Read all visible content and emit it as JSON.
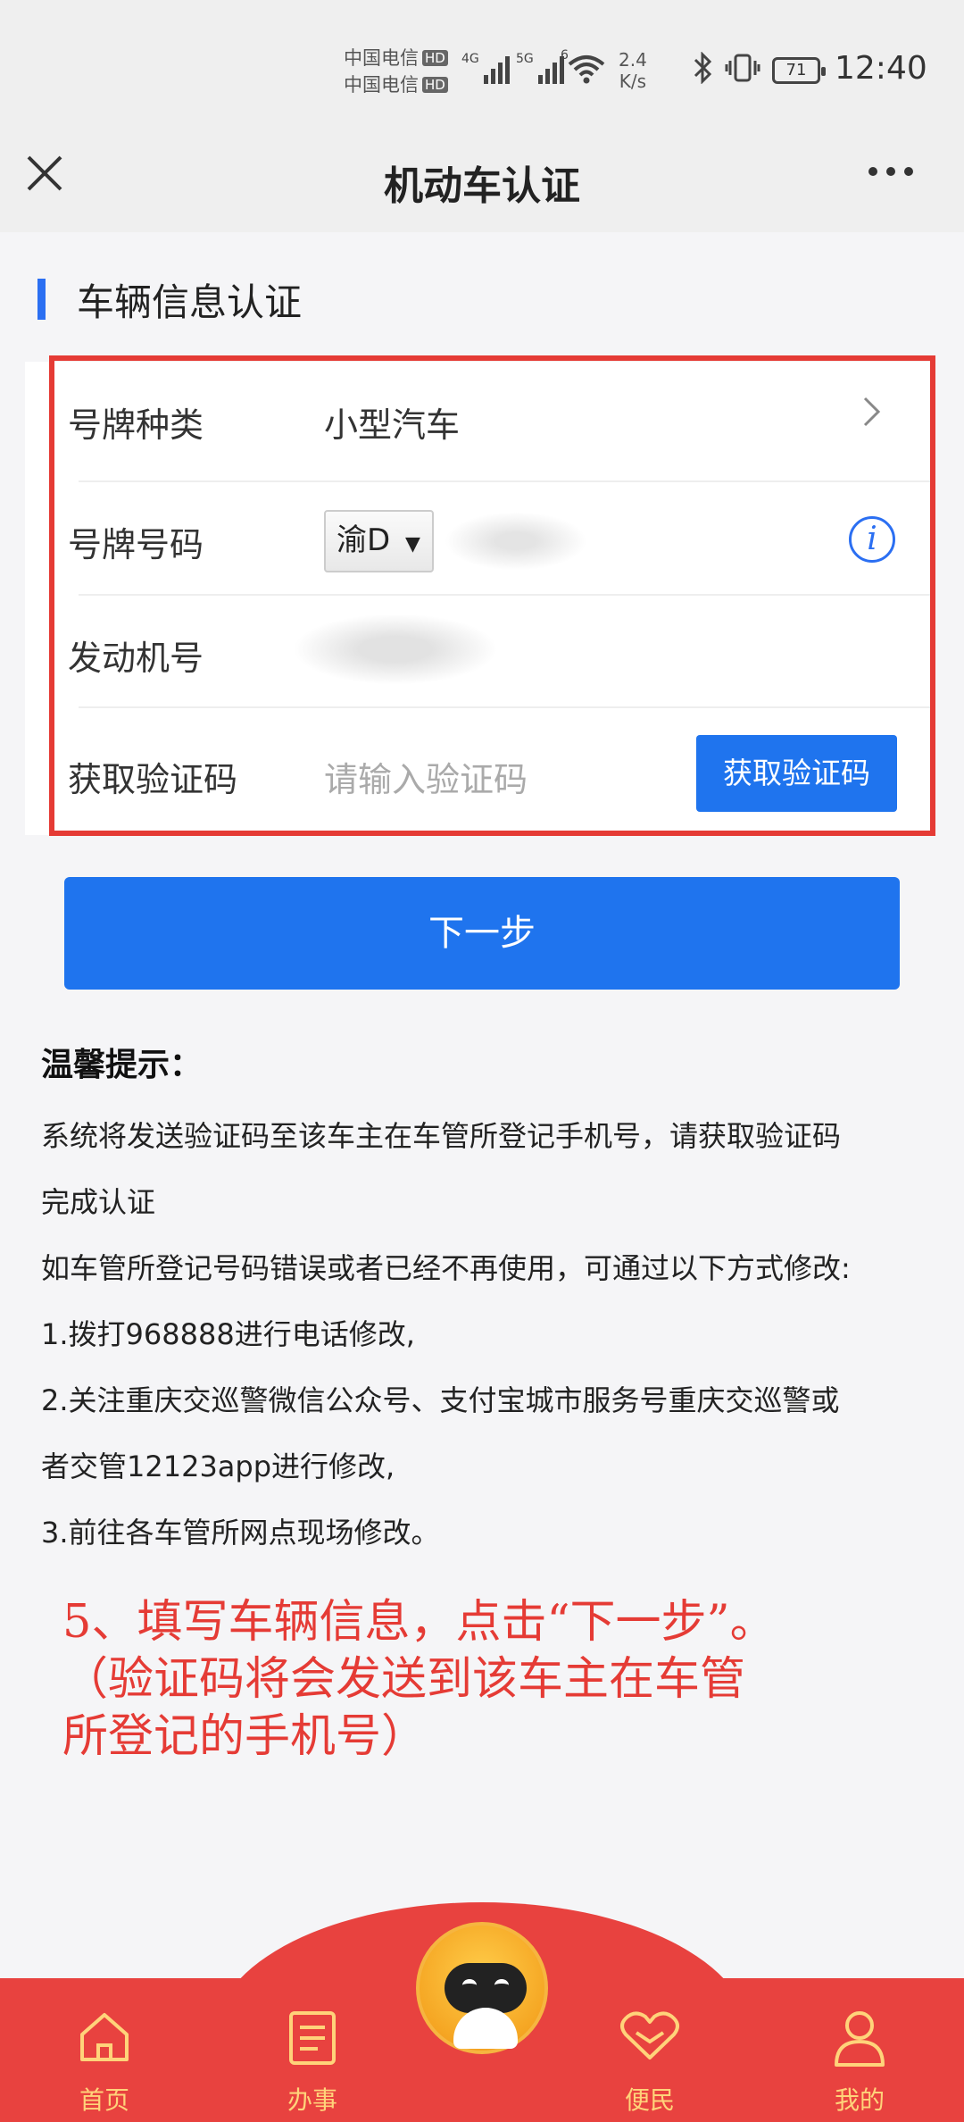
{
  "status_bar": {
    "carrier1": "中国电信",
    "carrier2": "中国电信",
    "hd": "HD",
    "net1": "4G",
    "net2": "5G",
    "wifi_label": "6",
    "speed_value": "2.4",
    "speed_unit": "K/s",
    "battery": "71",
    "time": "12:40"
  },
  "header": {
    "title": "机动车认证"
  },
  "section": {
    "title": "车辆信息认证"
  },
  "form": {
    "plate_type_label": "号牌种类",
    "plate_type_value": "小型汽车",
    "plate_number_label": "号牌号码",
    "plate_prefix": "渝D",
    "plate_prefix_arrow": "▼",
    "engine_label": "发动机号",
    "code_label": "获取验证码",
    "code_placeholder": "请输入验证码",
    "code_button": "获取验证码"
  },
  "next_button": "下一步",
  "tips": {
    "title": "温馨提示：",
    "lines": [
      "系统将发送验证码至该车主在车管所登记手机号，请获取验证码",
      "完成认证",
      "如车管所登记号码错误或者已经不再使用，可通过以下方式修改:",
      "1.拨打968888进行电话修改,",
      "2.关注重庆交巡警微信公众号、支付宝城市服务号重庆交巡警或",
      "者交管12123app进行修改,",
      "3.前往各车管所网点现场修改。"
    ]
  },
  "annotation": {
    "line1": "5、填写车辆信息，点击“下一步”。",
    "line2": "（验证码将会发送到该车主在车管",
    "line3": "所登记的手机号）"
  },
  "nav": {
    "items": [
      {
        "label": "首页",
        "icon": "home-icon"
      },
      {
        "label": "办事",
        "icon": "document-icon"
      },
      {
        "label": "便民",
        "icon": "heart-icon"
      },
      {
        "label": "我的",
        "icon": "user-icon"
      }
    ],
    "center_icon": "robot-assistant-icon",
    "accent": "#e8423f",
    "text_color": "#ffd37a"
  },
  "colors": {
    "primary": "#1f74ee",
    "annotation": "#e53b35"
  }
}
